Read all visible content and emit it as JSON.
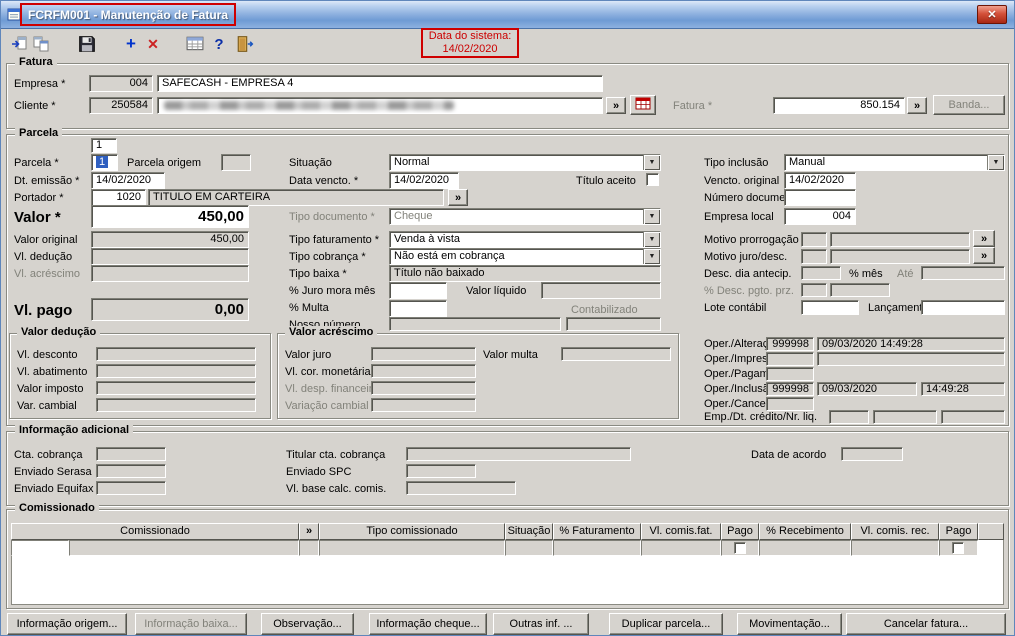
{
  "window": {
    "title": "FCRFM001 - Manutenção de Fatura"
  },
  "glyphs": {
    "close": "✕",
    "add": "+",
    "delete": "✕",
    "help": "?",
    "lookup": "»"
  },
  "colors": {
    "annotation_red": "#cc0000",
    "titlebar_blue": "#6f9bd4",
    "selection_blue": "#2f5fc0",
    "form_gray": "#d6d3ce"
  },
  "toolbar": {
    "system_date_label": "Data do sistema:",
    "system_date_value": "14/02/2020"
  },
  "fatura": {
    "legend": "Fatura",
    "empresa_label": "Empresa *",
    "empresa_code": "004",
    "empresa_name": "SAFECASH - EMPRESA 4",
    "cliente_label": "Cliente *",
    "cliente_code": "250584",
    "fatura_label": "Fatura *",
    "fatura_number": "850.154",
    "banda_button": "Banda..."
  },
  "parcela": {
    "legend": "Parcela",
    "tab_value": "1",
    "parcela_label": "Parcela *",
    "parcela_value": "1",
    "parcela_origem_label": "Parcela origem",
    "situacao_label": "Situação",
    "situacao_value": "Normal",
    "tipo_inclusao_label": "Tipo inclusão",
    "tipo_inclusao_value": "Manual",
    "dt_emissao_label": "Dt. emissão *",
    "dt_emissao_value": "14/02/2020",
    "data_vencto_label": "Data vencto. *",
    "data_vencto_value": "14/02/2020",
    "titulo_aceito_label": "Título aceito",
    "vencto_original_label": "Vencto. original",
    "vencto_original_value": "14/02/2020",
    "portador_label": "Portador *",
    "portador_code": "1020",
    "portador_name": "TITULO EM CARTEIRA",
    "numero_documento_label": "Número documento",
    "valor_label": "Valor *",
    "valor_value": "450,00",
    "tipo_documento_label": "Tipo documento *",
    "tipo_documento_value": "Cheque",
    "empresa_local_label": "Empresa local",
    "empresa_local_value": "004",
    "valor_original_label": "Valor original",
    "valor_original_value": "450,00",
    "tipo_faturamento_label": "Tipo faturamento *",
    "tipo_faturamento_value": "Venda à vista",
    "motivo_prorrogacao_label": "Motivo prorrogação",
    "vl_deducao_label": "Vl. dedução",
    "tipo_cobranca_label": "Tipo cobrança *",
    "tipo_cobranca_value": "Não está em cobrança",
    "motivo_juro_label": "Motivo juro/desc.",
    "vl_acrescimo_label": "Vl. acréscimo",
    "tipo_baixa_label": "Tipo baixa *",
    "tipo_baixa_value": "Título não baixado",
    "desc_dia_antecip_label": "Desc. dia antecip.",
    "pct_mes_label": "% mês",
    "ate_label": "Até",
    "juro_mora_label": "% Juro mora mês",
    "valor_liquido_label": "Valor líquido",
    "pct_desc_pgto_label": "% Desc. pgto. prz.",
    "vl_pago_label": "Vl. pago",
    "vl_pago_value": "0,00",
    "multa_label": "% Multa",
    "contabilizado_label": "Contabilizado",
    "lote_contabil_label": "Lote contábil",
    "lancamento_label": "Lançamento",
    "nosso_numero_label": "Nosso número",
    "oper_alteracao_label": "Oper./Alteração",
    "oper_alteracao_user": "999998",
    "oper_alteracao_datetime": "09/03/2020 14:49:28",
    "oper_impressao_label": "Oper./Impressão",
    "oper_pagamento_label": "Oper./Pagamento",
    "oper_inclusao_label": "Oper./Inclusão",
    "oper_inclusao_user": "999998",
    "oper_inclusao_date": "09/03/2020",
    "oper_inclusao_time": "14:49:28",
    "oper_cancelamento_label": "Oper./Cancelamento",
    "emp_dt_credito_label": "Emp./Dt. crédito/Nr. liq."
  },
  "valor_deducao": {
    "legend": "Valor dedução",
    "vl_desconto_label": "Vl. desconto",
    "vl_abatimento_label": "Vl. abatimento",
    "valor_imposto_label": "Valor imposto",
    "var_cambial_label": "Var. cambial"
  },
  "valor_acrescimo": {
    "legend": "Valor acréscimo",
    "valor_juro_label": "Valor juro",
    "valor_multa_label": "Valor multa",
    "vl_cor_monetaria_label": "Vl. cor. monetária",
    "vl_desp_financeira_label": "Vl. desp. financeira",
    "variacao_cambial_label": "Variação cambial"
  },
  "info_adicional": {
    "legend": "Informação adicional",
    "cta_cobranca_label": "Cta. cobrança",
    "titular_label": "Titular cta. cobrança",
    "data_acordo_label": "Data de acordo",
    "enviado_serasa_label": "Enviado Serasa",
    "enviado_spc_label": "Enviado SPC",
    "enviado_equifax_label": "Enviado Equifax",
    "vl_base_label": "Vl. base calc. comis."
  },
  "comissionado": {
    "legend": "Comissionado",
    "headers": [
      "Comissionado",
      "»",
      "Tipo comissionado",
      "Situação",
      "% Faturamento",
      "Vl. comis.fat.",
      "Pago",
      "% Recebimento",
      "Vl. comis. rec.",
      "Pago"
    ]
  },
  "footer": {
    "buttons": [
      "Informação origem...",
      "Informação baixa...",
      "Observação...",
      "Informação cheque...",
      "Outras inf. ...",
      "Duplicar parcela...",
      "Movimentação...",
      "Cancelar fatura..."
    ]
  }
}
